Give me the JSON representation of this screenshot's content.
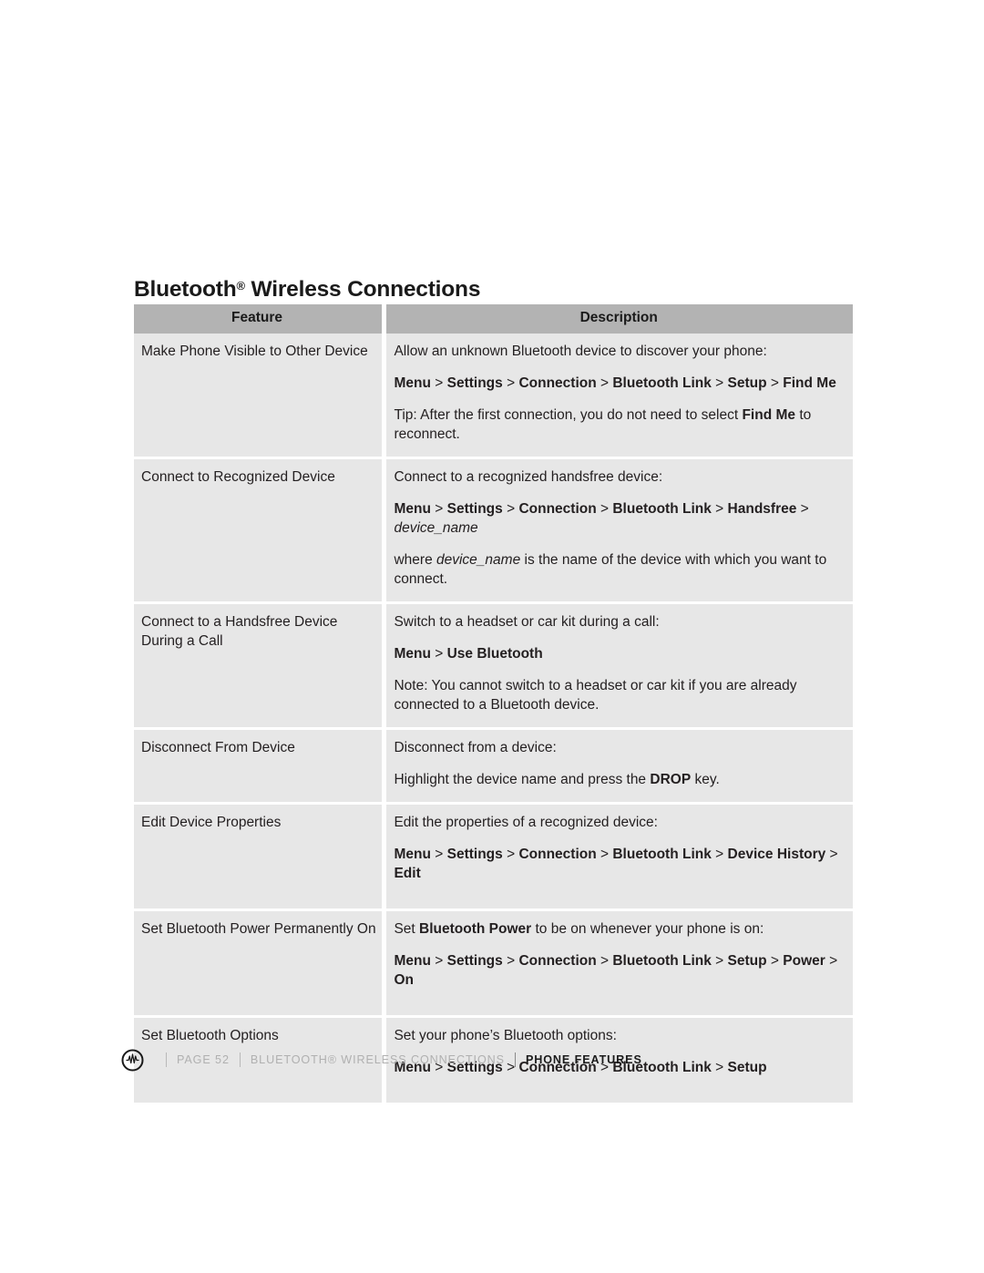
{
  "document": {
    "section_title_main": "Bluetooth",
    "section_title_reg": "®",
    "section_title_rest": " Wireless Connections"
  },
  "colors": {
    "header_row_bg": "#b3b3b3",
    "body_row_bg": "#e7e7e7",
    "page_bg": "#ffffff",
    "text": "#231f20",
    "footer_muted": "#b0b0b0",
    "footer_strong": "#1a1a1a"
  },
  "table": {
    "headers": {
      "feature": "Feature",
      "description": "Description"
    },
    "rows": [
      {
        "feature": "Make Phone Visible to Other Device",
        "feature_lines": [
          "Make Phone Visible to Other Device"
        ],
        "blocks": [
          {
            "kind": "text",
            "text": "Allow an unknown Bluetooth device to discover your phone:"
          },
          {
            "kind": "path",
            "text": "Menu > Settings > Connection > Bluetooth Link > Setup > Find Me"
          },
          {
            "kind": "text",
            "text": "Tip: After the first connection, you do not need to select Find Me to reconnect."
          }
        ]
      },
      {
        "feature": "Connect to Recognized Device",
        "feature_lines": [
          "Connect to Recognized Device"
        ],
        "blocks": [
          {
            "kind": "text",
            "text": "Connect to a recognized handsfree device:"
          },
          {
            "kind": "path",
            "text": "Menu > Settings > Connection > Bluetooth Link > Handsfree > device_name"
          },
          {
            "kind": "text",
            "text": "where device_name is the name of the device with which you want to connect."
          }
        ]
      },
      {
        "feature": "Connect to a Handsfree Device During a Call",
        "feature_lines": [
          "Connect to a Handsfree Device",
          "During a Call"
        ],
        "blocks": [
          {
            "kind": "text",
            "text": "Switch to a headset or car kit during a call:"
          },
          {
            "kind": "path",
            "text": "Menu > Use Bluetooth"
          },
          {
            "kind": "text",
            "text": "Note: You cannot switch to a headset or car kit if you are already connected to a Bluetooth device."
          }
        ]
      },
      {
        "feature": "Disconnect From Device",
        "feature_lines": [
          "Disconnect From Device"
        ],
        "blocks": [
          {
            "kind": "text",
            "text": "Disconnect from a device:"
          },
          {
            "kind": "text",
            "text": "Highlight the device name and press the DROP key."
          }
        ]
      },
      {
        "feature": "Edit Device Properties",
        "feature_lines": [
          "Edit Device Properties"
        ],
        "blocks": [
          {
            "kind": "text",
            "text": "Edit the properties of a recognized device:"
          },
          {
            "kind": "path",
            "text": "Menu >  Settings > Connection > Bluetooth Link > Device History > Edit"
          }
        ]
      },
      {
        "feature": "Set Bluetooth Power Permanently On",
        "feature_lines": [
          "Set Bluetooth Power Permanently On"
        ],
        "blocks": [
          {
            "kind": "text",
            "text": "Set Bluetooth Power to be on whenever your phone is on:"
          },
          {
            "kind": "path",
            "text": "Menu >  Settings > Connection > Bluetooth Link > Setup > Power > On"
          }
        ]
      },
      {
        "feature": "Set Bluetooth Options",
        "feature_lines": [
          "Set Bluetooth Options"
        ],
        "blocks": [
          {
            "kind": "text",
            "text": "Set your phone’s Bluetooth options:"
          },
          {
            "kind": "path",
            "text": "Menu > Settings > Connection > Bluetooth Link > Setup"
          }
        ]
      }
    ]
  },
  "footer": {
    "logo_icon": "motorola-m-logo-icon",
    "page_label": "PAGE 52",
    "section_label": "BLUETOOTH® WIRELESS CONNECTIONS",
    "chapter_label": "PHONE FEATURES"
  }
}
